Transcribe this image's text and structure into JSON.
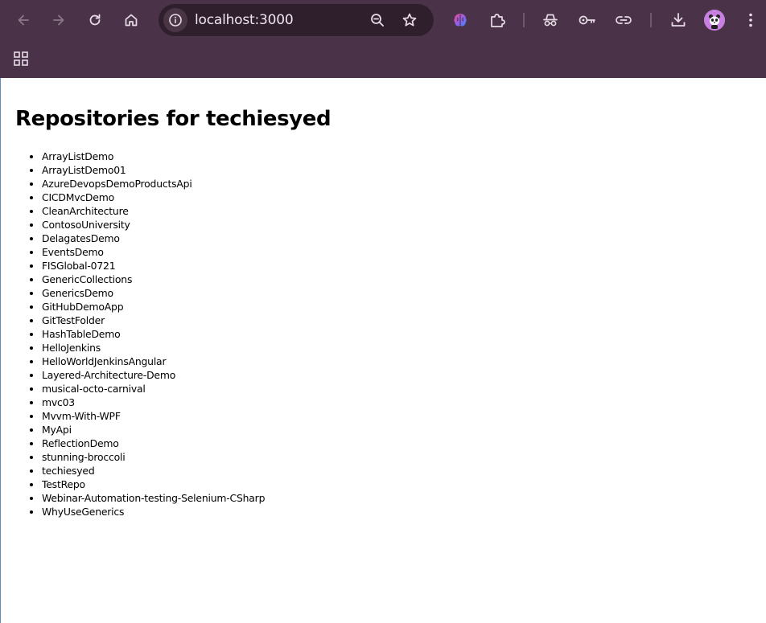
{
  "browser": {
    "url": "localhost:3000",
    "icons": {
      "back": "arrow-left-icon",
      "forward": "arrow-right-icon",
      "reload": "reload-icon",
      "home": "home-icon",
      "site_info": "info-icon",
      "zoom": "zoom-out-icon",
      "bookmark": "star-icon",
      "gemini": "brain-icon",
      "extensions": "puzzle-icon",
      "incognito": "incognito-icon",
      "passwords": "key-icon",
      "link": "link-icon",
      "downloads": "download-icon",
      "menu": "kebab-menu-icon",
      "apps": "apps-grid-icon"
    },
    "colors": {
      "chrome_bg": "#4a3248",
      "omnibox_bg": "#2f1f2d",
      "icon": "#e8dce6",
      "avatar_bg": "#c77fe0"
    }
  },
  "page": {
    "title": "Repositories for techiesyed",
    "repositories": [
      "ArrayListDemo",
      "ArrayListDemo01",
      "AzureDevopsDemoProductsApi",
      "CICDMvcDemo",
      "CleanArchitecture",
      "ContosoUniversity",
      "DelagatesDemo",
      "EventsDemo",
      "FISGlobal-0721",
      "GenericCollections",
      "GenericsDemo",
      "GitHubDemoApp",
      "GitTestFolder",
      "HashTableDemo",
      "HelloJenkins",
      "HelloWorldJenkinsAngular",
      "Layered-Architecture-Demo",
      "musical-octo-carnival",
      "mvc03",
      "Mvvm-With-WPF",
      "MyApi",
      "ReflectionDemo",
      "stunning-broccoli",
      "techiesyed",
      "TestRepo",
      "Webinar-Automation-testing-Selenium-CSharp",
      "WhyUseGenerics"
    ]
  }
}
